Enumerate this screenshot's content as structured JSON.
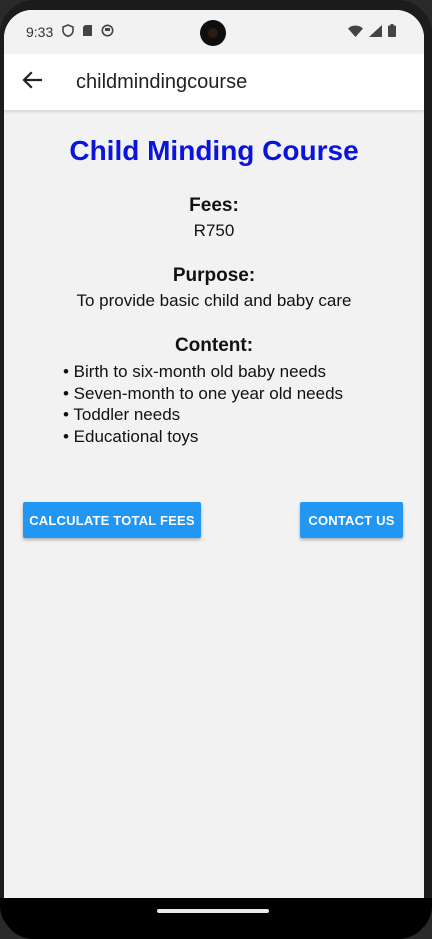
{
  "status_bar": {
    "time": "9:33",
    "left_icons": [
      "shield-icon",
      "sd-card-icon",
      "notification-icon"
    ],
    "right_icons": [
      "wifi-icon",
      "signal-icon",
      "battery-icon"
    ]
  },
  "app_bar": {
    "title": "childmindingcourse",
    "back_icon": "arrow-back-icon"
  },
  "course": {
    "title": "Child Minding Course",
    "title_color": "#0a14dc",
    "fees_label": "Fees:",
    "fees_value": "R750",
    "purpose_label": "Purpose:",
    "purpose_value": "To provide basic child and baby care",
    "content_label": "Content:",
    "content_items": [
      "• Birth to six-month old baby needs",
      "• Seven-month to one year old needs",
      "• Toddler needs",
      "• Educational toys"
    ]
  },
  "actions": {
    "calculate_label": "CALCULATE TOTAL FEES",
    "contact_label": "CONTACT US",
    "button_color": "#2196f3"
  }
}
